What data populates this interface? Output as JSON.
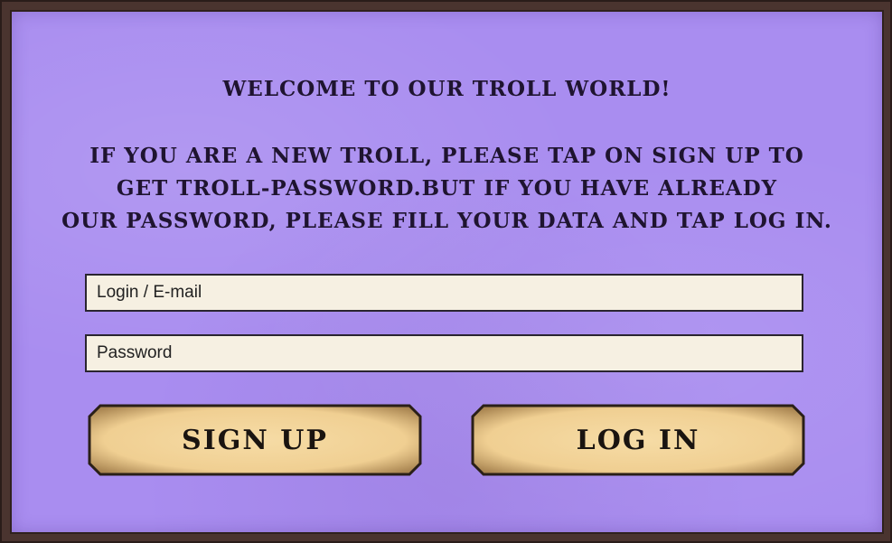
{
  "screen": {
    "title": "WELCOME TO OUR TROLL WORLD!",
    "instructions": [
      "IF YOU ARE A NEW TROLL, PLEASE TAP ON SIGN UP TO",
      "GET TROLL-PASSWORD.BUT IF YOU HAVE ALREADY",
      "OUR PASSWORD, PLEASE FILL YOUR DATA AND TAP LOG IN."
    ]
  },
  "form": {
    "login_placeholder": "Login / E-mail",
    "login_value": "",
    "password_placeholder": "Password",
    "password_value": ""
  },
  "buttons": {
    "signup_label": "SIGN UP",
    "login_label": "LOG IN"
  },
  "colors": {
    "panel_background": "#a98df0",
    "frame": "#4a342f",
    "field_background": "#f6f0e2",
    "button_fill": "#f1d39a",
    "button_border": "#2a1f18",
    "text": "#1f1430"
  }
}
